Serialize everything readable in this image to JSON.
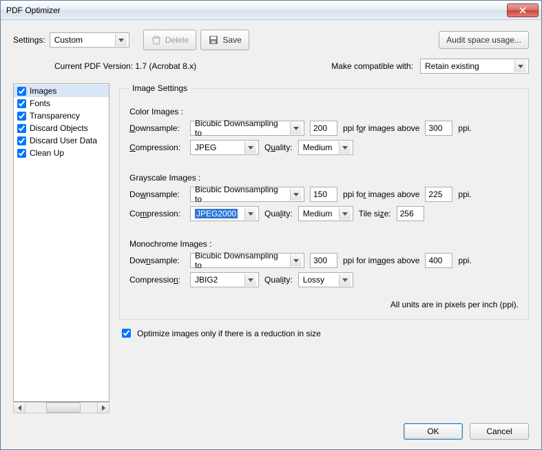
{
  "window": {
    "title": "PDF Optimizer"
  },
  "toolbar": {
    "settings_label": "Settings:",
    "settings_value": "Custom",
    "delete_label": "Delete",
    "save_label": "Save",
    "audit_label": "Audit space usage..."
  },
  "version": {
    "current_label": "Current PDF Version: 1.7 (Acrobat 8.x)",
    "compat_label": "Make compatible with:",
    "compat_value": "Retain existing"
  },
  "categories": [
    {
      "label": "Images",
      "checked": true,
      "selected": true
    },
    {
      "label": "Fonts",
      "checked": true,
      "selected": false
    },
    {
      "label": "Transparency",
      "checked": true,
      "selected": false
    },
    {
      "label": "Discard Objects",
      "checked": true,
      "selected": false
    },
    {
      "label": "Discard User Data",
      "checked": true,
      "selected": false
    },
    {
      "label": "Clean Up",
      "checked": true,
      "selected": false
    }
  ],
  "image_settings": {
    "legend": "Image Settings",
    "color": {
      "title": "Color Images :",
      "downsample_label": "Downsample:",
      "method": "Bicubic Downsampling to",
      "ppi": "200",
      "above_label": "ppi for images above",
      "above_ppi": "300",
      "ppi_unit": "ppi.",
      "compression_label": "Compression:",
      "compression": "JPEG",
      "quality_label": "Quality:",
      "quality": "Medium"
    },
    "gray": {
      "title": "Grayscale Images :",
      "downsample_label": "Downsample:",
      "method": "Bicubic Downsampling to",
      "ppi": "150",
      "above_label": "ppi for images above",
      "above_ppi": "225",
      "ppi_unit": "ppi.",
      "compression_label": "Compression:",
      "compression": "JPEG2000",
      "quality_label": "Quality:",
      "quality": "Medium",
      "tile_label": "Tile size:",
      "tile": "256"
    },
    "mono": {
      "title": "Monochrome Images :",
      "downsample_label": "Downsample:",
      "method": "Bicubic Downsampling to",
      "ppi": "300",
      "above_label": "ppi for images above",
      "above_ppi": "400",
      "ppi_unit": "ppi.",
      "compression_label": "Compression:",
      "compression": "JBIG2",
      "quality_label": "Quality:",
      "quality": "Lossy"
    },
    "units_note": "All units are in pixels per inch (ppi)."
  },
  "optimize_checkbox": {
    "label": "Optimize images only if there is a reduction in size",
    "checked": true
  },
  "buttons": {
    "ok": "OK",
    "cancel": "Cancel"
  }
}
